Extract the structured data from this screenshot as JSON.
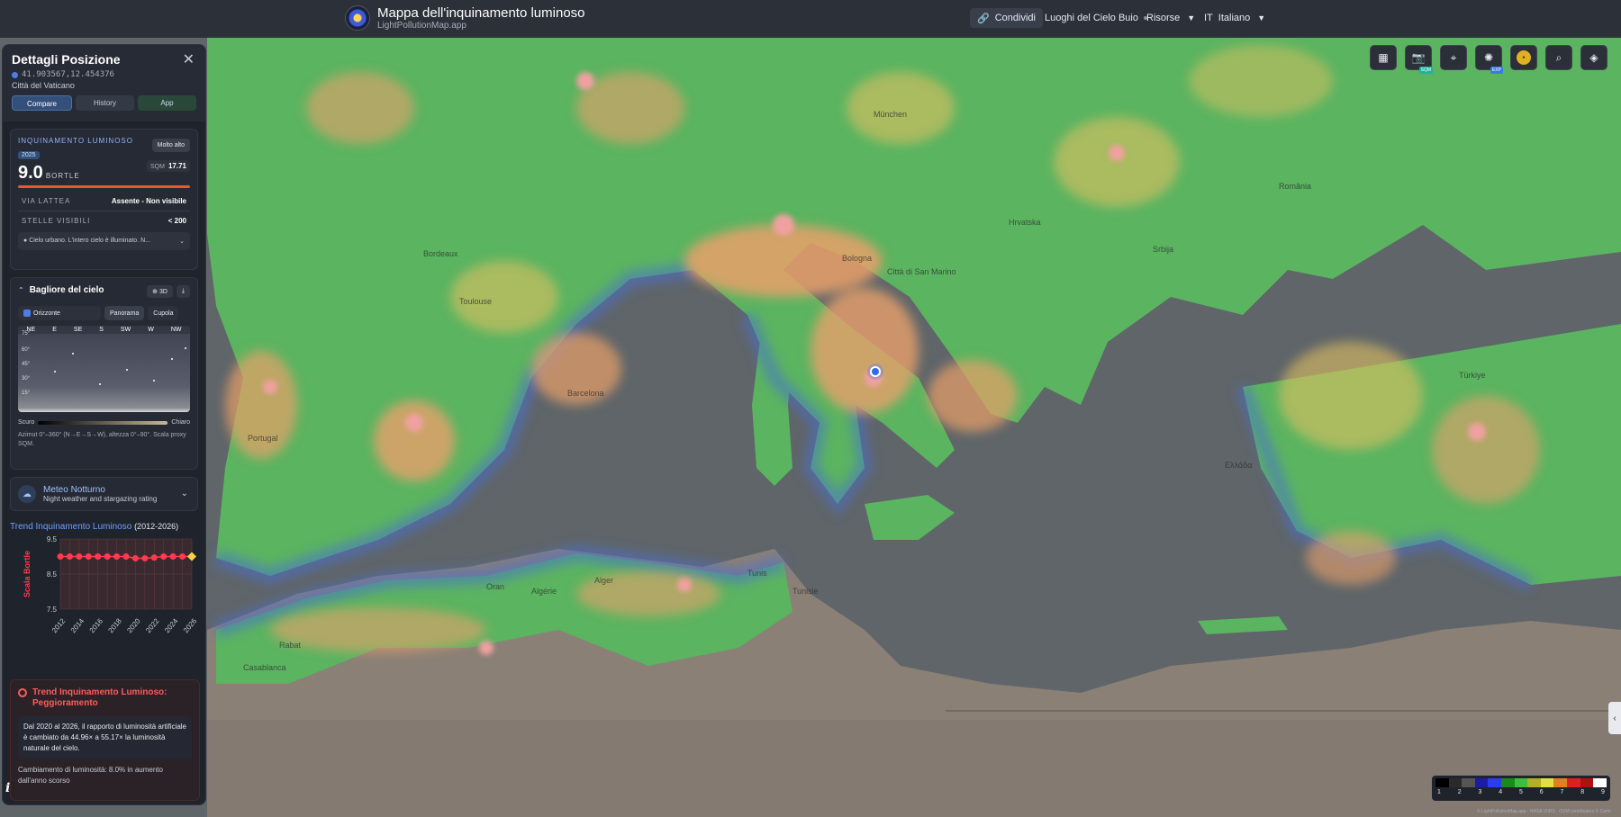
{
  "header": {
    "app_title": "Mappa dell'inquinamento luminoso",
    "app_subtitle": "LightPollutionMap.app",
    "share_label": "Condividi",
    "dark_places_label": "Luoghi del Cielo Buio",
    "resources_label": "Risorse",
    "language_code": "IT",
    "language_label": "Italiano"
  },
  "sidebar": {
    "title": "Dettagli Posizione",
    "coords": "41.903567,12.454376",
    "place": "Città del Vaticano",
    "tabs": [
      "Compare",
      "History",
      "App"
    ],
    "pollution": {
      "label": "INQUINAMENTO LUMINOSO",
      "year": "2025",
      "badge": "Molto alto",
      "sqm_label": "SQM",
      "sqm_value": "17.71",
      "bortle_value": "9.0",
      "bortle_unit": "BORTLE",
      "milky_way_label": "VIA LATTEA",
      "milky_way_value": "Assente - Non visibile",
      "stars_label": "STELLE VISIBILI",
      "stars_value": "< 200",
      "note": "Cielo urbano. L'intero cielo è illuminato. N..."
    },
    "skyglow": {
      "title": "Bagliore del cielo",
      "btn_3d": "3D",
      "opt_horizon": "Orizzonte",
      "opt_panorama": "Panorama",
      "opt_dome": "Cupola",
      "directions": [
        "NE",
        "E",
        "SE",
        "S",
        "SW",
        "W",
        "NW"
      ],
      "altitudes": [
        "75°",
        "60°",
        "45°",
        "30°",
        "15°"
      ],
      "scale_dark": "Scuro",
      "scale_bright": "Chiaro",
      "footnote": "Azimut 0°–360° (N→E→S→W), altezza 0°–90°. Scala proxy SQM."
    },
    "meteo": {
      "title": "Meteo Notturno",
      "subtitle": "Night weather and stargazing rating"
    },
    "trend": {
      "title": "Trend Inquinamento Luminoso",
      "range": "(2012-2026)"
    },
    "worsening": {
      "title": "Trend Inquinamento Luminoso: Peggioramento",
      "body": "Dal 2020 al 2026, il rapporto di luminosità artificiale è cambiato da 44.96× a 55.17× la luminosità naturale del cielo.",
      "change": "Cambiamento di luminosità: 8.0% in aumento dall'anno scorso"
    }
  },
  "chart_data": {
    "type": "line",
    "title": "Trend Inquinamento Luminoso",
    "ylabel": "Scala Bortle",
    "xlabel": "",
    "ylim": [
      7.5,
      9.5
    ],
    "yticks": [
      9.5,
      8.5,
      7.5
    ],
    "xticks": [
      2012,
      2014,
      2016,
      2018,
      2020,
      2022,
      2024,
      2026
    ],
    "x": [
      2012,
      2013,
      2014,
      2015,
      2016,
      2017,
      2018,
      2019,
      2020,
      2021,
      2022,
      2023,
      2024,
      2025,
      2026
    ],
    "values": [
      9.0,
      9.0,
      9.0,
      9.0,
      9.0,
      9.0,
      9.0,
      9.0,
      8.95,
      8.95,
      8.97,
      9.0,
      9.0,
      9.0,
      9.0
    ],
    "highlight_x": 2026,
    "colors": {
      "line": "#ff3b4e",
      "highlight": "#ffd23f"
    }
  },
  "map_tools": [
    {
      "name": "grid",
      "tag": ""
    },
    {
      "name": "camera",
      "tag": "SQM"
    },
    {
      "name": "pin",
      "tag": ""
    },
    {
      "name": "compare",
      "tag": "EXP"
    },
    {
      "name": "brightness",
      "tag": ""
    },
    {
      "name": "search",
      "tag": ""
    },
    {
      "name": "layers",
      "tag": ""
    }
  ],
  "legend": {
    "numbers": [
      "1",
      "2",
      "3",
      "4",
      "5",
      "6",
      "7",
      "8",
      "9"
    ],
    "colors": [
      "#000000",
      "#2a2a2a",
      "#555555",
      "#1b1ba8",
      "#2a3df0",
      "#1a8a1a",
      "#3cc03c",
      "#b0b020",
      "#e0e040",
      "#e08020",
      "#e02020",
      "#b01010",
      "#ffffff"
    ]
  },
  "credit": "© LightPollutionMap.app · NASA VIIRS · OSM contributors © Carto",
  "map_labels": [
    "München",
    "Bordeaux",
    "Toulouse",
    "Barcelona",
    "Portugal",
    "Bologna",
    "Città di San Marino",
    "Algérie",
    "Tunisie",
    "Rabat",
    "Casablanca",
    "Oran",
    "Alger",
    "Tunis",
    "Ελλάδα",
    "Türkiye",
    "Srbija",
    "Hrvatska",
    "România"
  ]
}
